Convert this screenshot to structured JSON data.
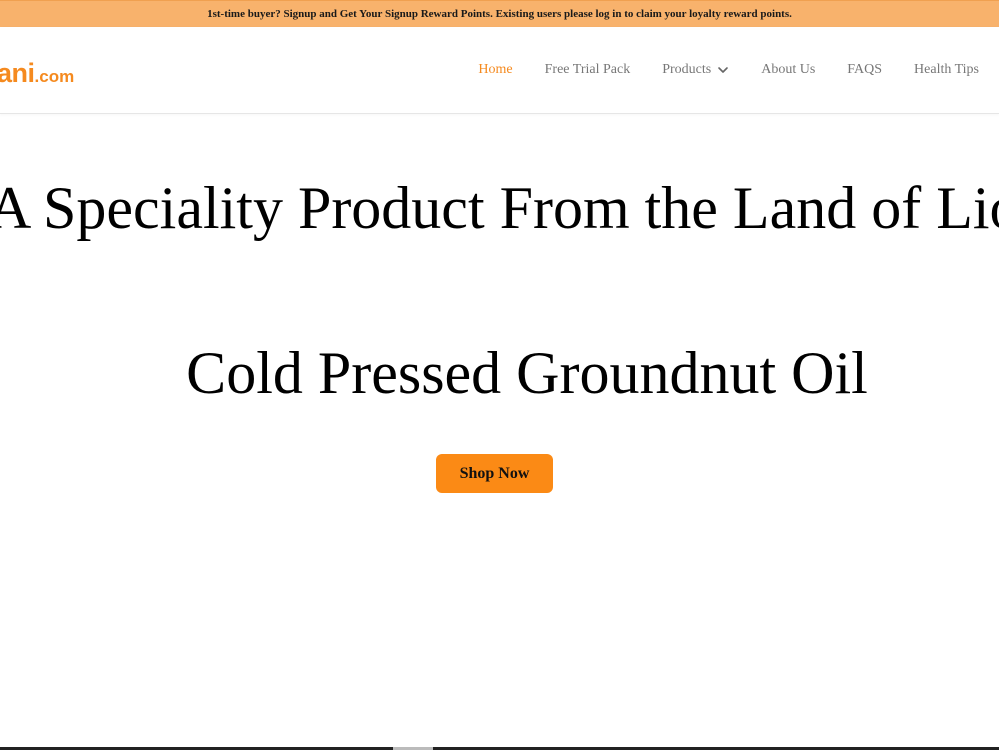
{
  "promo": {
    "text": "1st-time buyer? Signup and Get Your Signup Reward Points. Existing users please log in to claim your loyalty reward points."
  },
  "header": {
    "logo_main": "ani",
    "logo_suffix": ".com",
    "nav": {
      "home": "Home",
      "free_trial": "Free Trial Pack",
      "products": "Products",
      "about": "About Us",
      "faqs": "FAQS",
      "health_tips": "Health Tips"
    },
    "active_item": "Home"
  },
  "hero": {
    "line1": "A Speciality Product From the Land of Lio",
    "line2": "Cold Pressed Groundnut Oil",
    "cta_label": "Shop Now"
  },
  "colors": {
    "accent": "#f58a1f",
    "promo_bg": "#f8b26c",
    "button_bg": "#fb8a15",
    "nav_text": "#777777"
  },
  "icons": {
    "products_dropdown": "chevron-down-icon"
  }
}
